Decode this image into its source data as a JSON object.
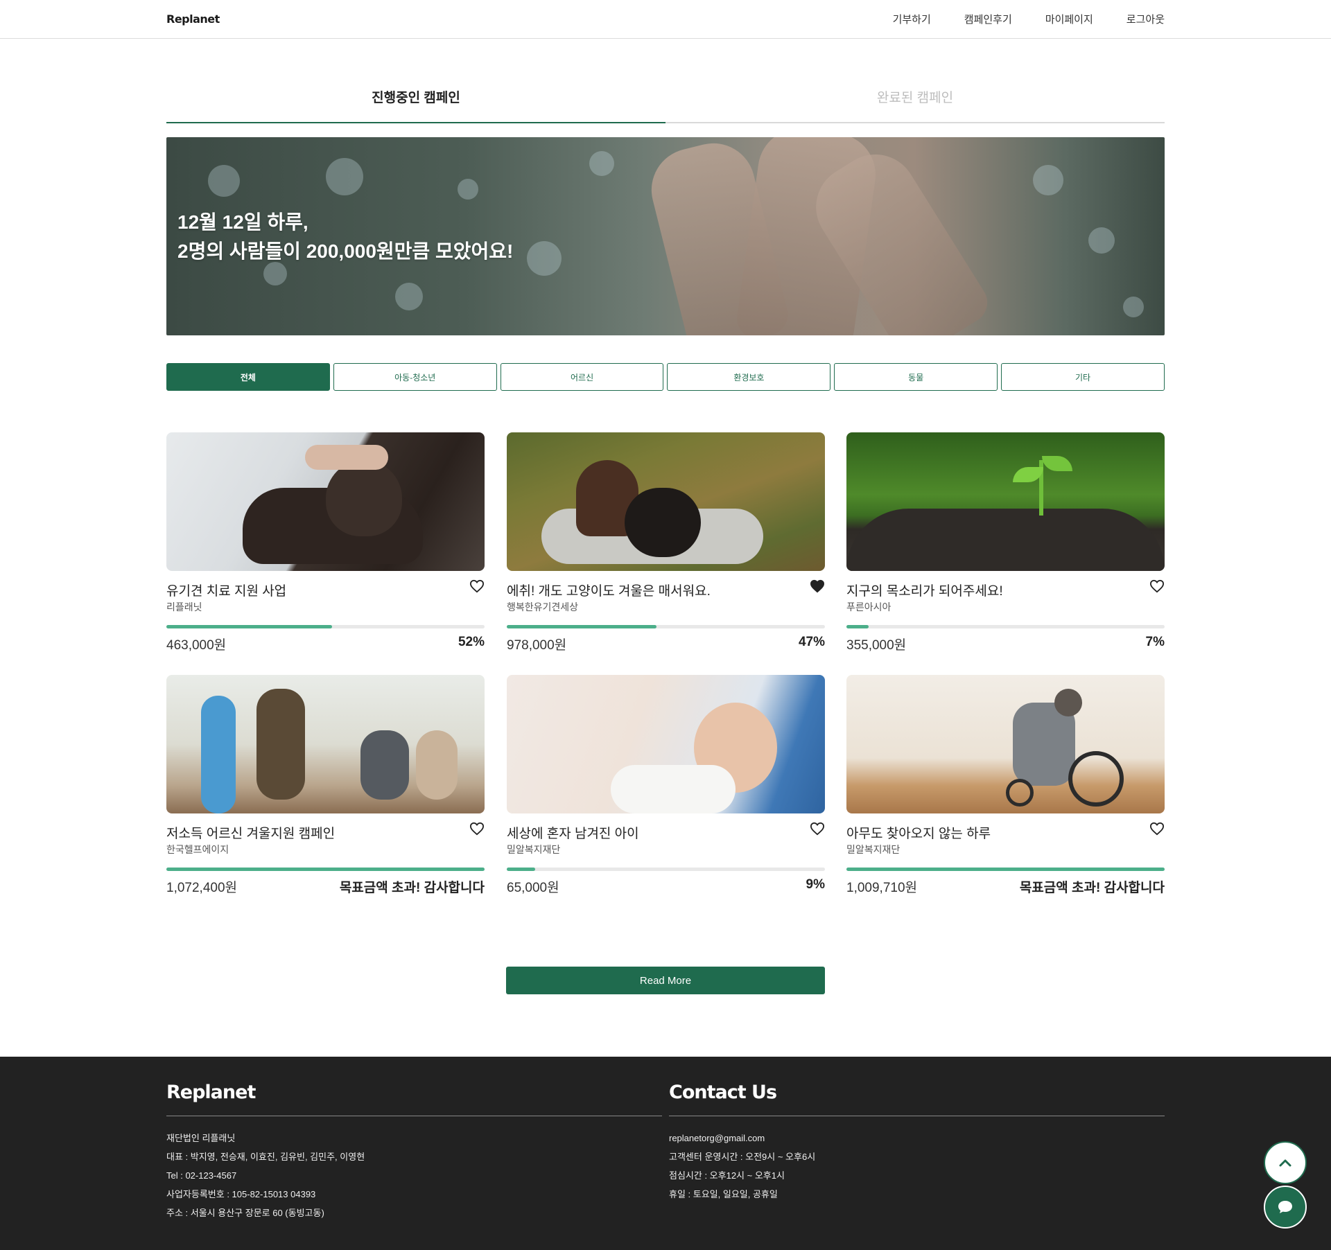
{
  "header": {
    "logo": "Replanet",
    "nav": [
      "기부하기",
      "캠페인후기",
      "마이페이지",
      "로그아웃"
    ]
  },
  "tabs": [
    {
      "label": "진행중인 캠페인",
      "active": true
    },
    {
      "label": "완료된 캠페인",
      "active": false
    }
  ],
  "hero": {
    "line1": "12월 12일 하루,",
    "line2": "2명의 사람들이 200,000원만큼 모았어요!"
  },
  "filters": [
    {
      "label": "전체",
      "active": true
    },
    {
      "label": "아동-청소년",
      "active": false
    },
    {
      "label": "어르신",
      "active": false
    },
    {
      "label": "환경보호",
      "active": false
    },
    {
      "label": "동물",
      "active": false
    },
    {
      "label": "기타",
      "active": false
    }
  ],
  "campaigns": [
    {
      "title": "유기견 치료 지원 사업",
      "org": "리플래닛",
      "amount": "463,000원",
      "status": "52%",
      "progress": 0.52,
      "liked": false,
      "image": "dog-at-vet"
    },
    {
      "title": "에취! 개도 고양이도 겨울은 매서워요.",
      "org": "행복한유기견세상",
      "amount": "978,000원",
      "status": "47%",
      "progress": 0.47,
      "liked": true,
      "image": "dogs-with-blanket"
    },
    {
      "title": "지구의 목소리가 되어주세요!",
      "org": "푸른아시아",
      "amount": "355,000원",
      "status": "7%",
      "progress": 0.07,
      "liked": false,
      "image": "seedling-in-soil"
    },
    {
      "title": "저소득 어르신 겨울지원 캠페인",
      "org": "한국헬프에이지",
      "amount": "1,072,400원",
      "status": "목표금액 초과! 감사합니다",
      "progress": 1.0,
      "liked": false,
      "image": "elderly-care-home"
    },
    {
      "title": "세상에 혼자 남겨진 아이",
      "org": "밀알복지재단",
      "amount": "65,000원",
      "status": "9%",
      "progress": 0.09,
      "liked": false,
      "image": "newborn-baby"
    },
    {
      "title": "아무도 찾아오지 않는 하루",
      "org": "밀알복지재단",
      "amount": "1,009,710원",
      "status": "목표금액 초과! 감사합니다",
      "progress": 1.0,
      "liked": false,
      "image": "wheelchair-by-window"
    }
  ],
  "read_more": "Read More",
  "footer": {
    "left": {
      "title": "Replanet",
      "lines": [
        "재단법인 리플래닛",
        "대표 : 박지영, 전승재, 이효진, 김유빈, 김민주, 이영현",
        "Tel : 02-123-4567",
        "사업자등록번호 : 105-82-15013 04393",
        "주소 : 서울시 용산구 장문로 60 (동빙고동)"
      ]
    },
    "right": {
      "title": "Contact Us",
      "lines": [
        "replanetorg@gmail.com",
        "고객센터 운영시간 : 오전9시 ~ 오후6시",
        "점심시간 : 오후12시 ~ 오후1시",
        "휴일 : 토요일, 일요일, 공휴일"
      ]
    }
  },
  "colors": {
    "accent": "#1f6b4e",
    "progress": "#4caf8a",
    "footer_bg": "#222222"
  },
  "icons": {
    "like": "heart-icon",
    "scroll_top": "chevron-up-icon",
    "chat": "chat-bubble-icon"
  }
}
